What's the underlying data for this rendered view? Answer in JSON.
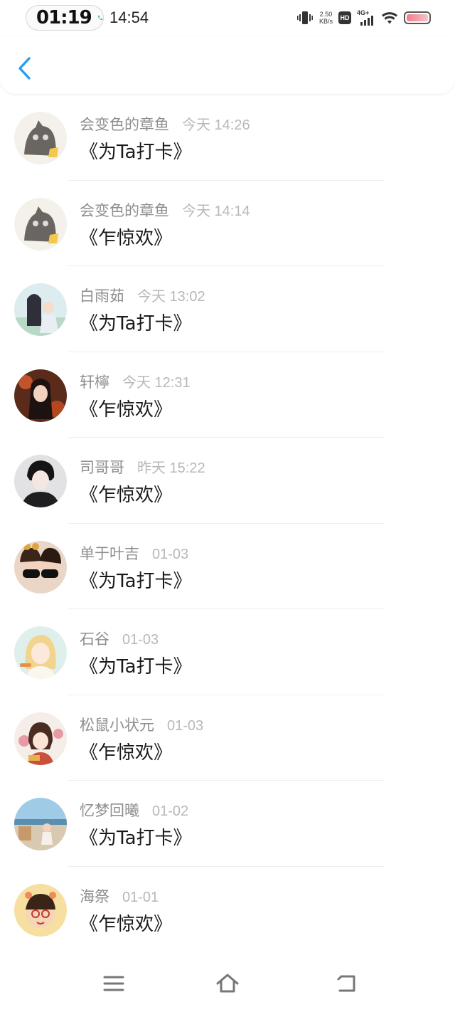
{
  "status_bar": {
    "call_timer": "01:19",
    "clock": "14:54",
    "net_speed_value": "2.50",
    "net_speed_unit": "KB/s",
    "hd_label": "HD",
    "network_label": "4G+",
    "call_color": "#2bb673"
  },
  "header": {
    "back_icon": "chevron-left-icon",
    "accent": "#2d9cf0"
  },
  "items": [
    {
      "name": "会变色的章鱼",
      "time": "今天 14:26",
      "message": "《为Ta打卡》"
    },
    {
      "name": "会变色的章鱼",
      "time": "今天 14:14",
      "message": "《乍惊欢》"
    },
    {
      "name": "白雨茹",
      "time": "今天 13:02",
      "message": "《为Ta打卡》"
    },
    {
      "name": "轩檸",
      "time": "今天 12:31",
      "message": "《乍惊欢》"
    },
    {
      "name": "司哥哥",
      "time": "昨天 15:22",
      "message": "《乍惊欢》"
    },
    {
      "name": "单于叶吉",
      "time": "01-03",
      "message": "《为Ta打卡》"
    },
    {
      "name": "石谷",
      "time": "01-03",
      "message": "《为Ta打卡》"
    },
    {
      "name": "松鼠小状元",
      "time": "01-03",
      "message": "《乍惊欢》"
    },
    {
      "name": "忆梦回曦",
      "time": "01-02",
      "message": "《为Ta打卡》"
    },
    {
      "name": "海祭",
      "time": "01-01",
      "message": "《乍惊欢》"
    }
  ],
  "bottom_nav": {
    "menu_icon": "menu-icon",
    "home_icon": "home-icon",
    "back_icon": "back-icon"
  }
}
